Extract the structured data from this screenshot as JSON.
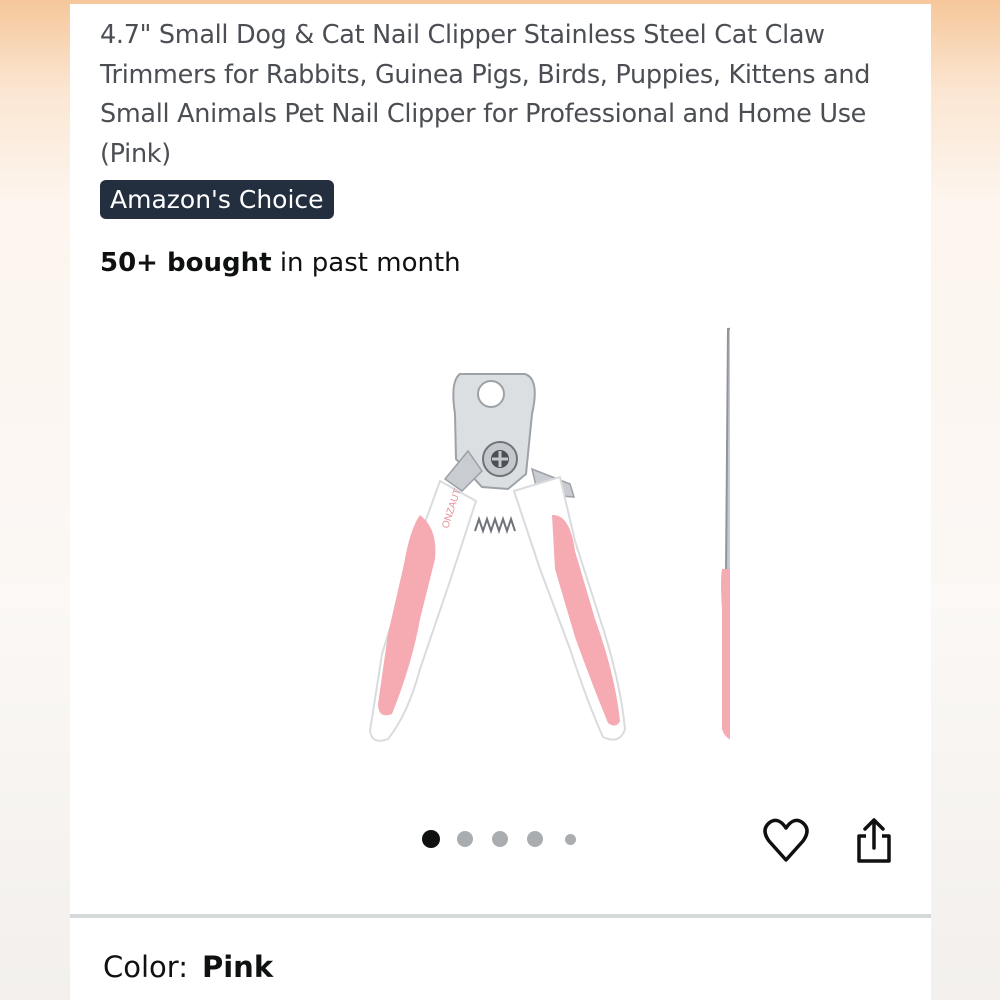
{
  "product": {
    "title": "4.7\" Small Dog & Cat Nail Clipper Stainless Steel Cat Claw Trimmers for Rabbits, Guinea Pigs, Birds, Puppies, Kittens and Small Animals Pet Nail Clipper for Professional and Home Use (Pink)",
    "badge": "Amazon's Choice",
    "bought_count": "50+ bought",
    "bought_suffix": " in past month",
    "brand_mark": "ONZAUT"
  },
  "gallery": {
    "image_count": 5,
    "active_index": 1,
    "icons": [
      "heart-icon",
      "share-icon"
    ]
  },
  "variation": {
    "label": "Color:",
    "value": "Pink"
  },
  "colors": {
    "badge_bg": "#232f3e",
    "handle_pink": "#f6aab2",
    "text": "#0f1111",
    "dot_inactive": "#a9adb0"
  }
}
